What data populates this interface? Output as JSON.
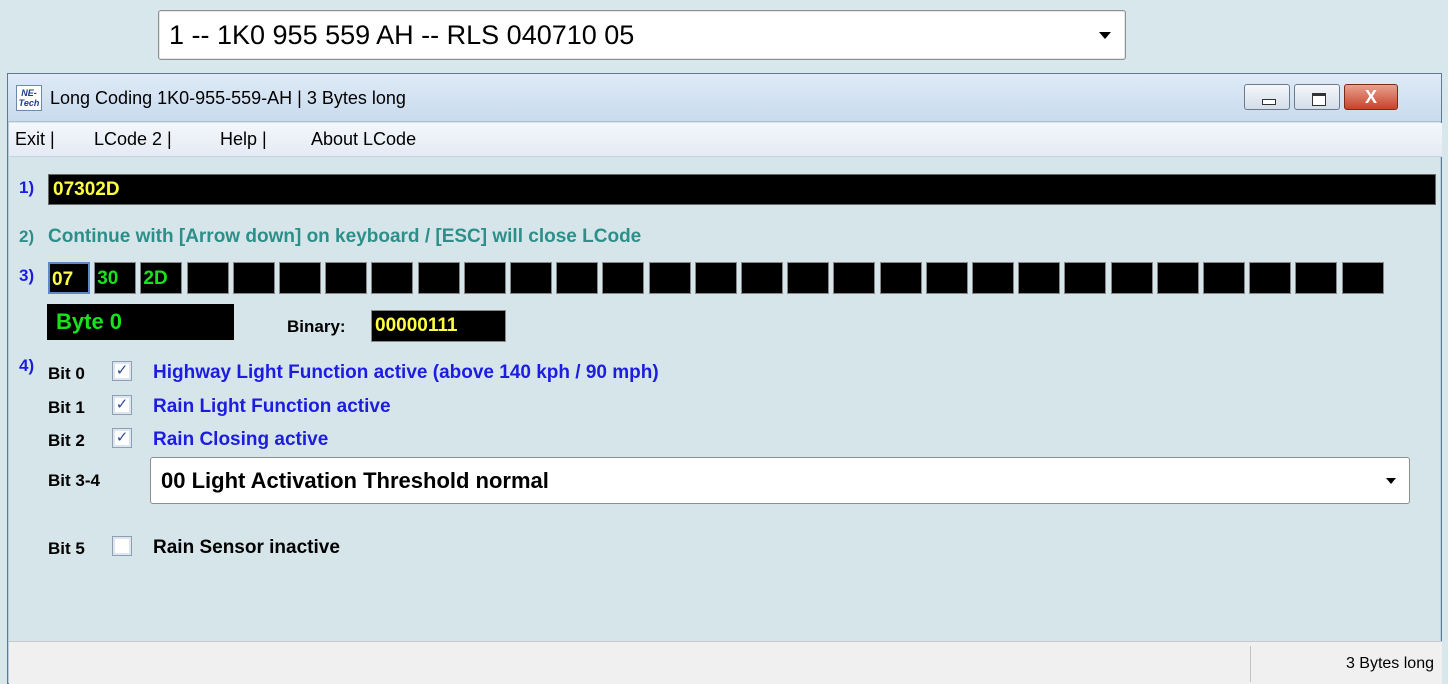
{
  "module_selector": {
    "value": "1 -- 1K0 955 559 AH -- RLS 040710 05"
  },
  "window": {
    "title": "Long Coding  1K0-955-559-AH | 3 Bytes long",
    "icon_text": "NE-Tech",
    "buttons": {
      "close_glyph": "X"
    }
  },
  "menu": [
    "Exit |",
    "LCode 2 |",
    "Help |",
    "About LCode"
  ],
  "rows": {
    "r1": "1)",
    "r2": "2)",
    "r3": "3)",
    "r4": "4)"
  },
  "coding_value": "07302D",
  "hint": "Continue with [Arrow down] on keyboard / [ESC] will close LCode",
  "bytes": [
    "07",
    "30",
    "2D",
    "",
    "",
    "",
    "",
    "",
    "",
    "",
    "",
    "",
    "",
    "",
    "",
    "",
    "",
    "",
    "",
    "",
    "",
    "",
    "",
    "",
    "",
    "",
    "",
    "",
    ""
  ],
  "byte_label": "Byte 0",
  "binary": {
    "label": "Binary:",
    "value": "00000111"
  },
  "bits": [
    {
      "label": "Bit 0",
      "checked": true,
      "description": "Highway Light Function active (above 140 kph / 90 mph)"
    },
    {
      "label": "Bit 1",
      "checked": true,
      "description": "Rain Light Function active"
    },
    {
      "label": "Bit 2",
      "checked": true,
      "description": "Rain Closing active"
    },
    {
      "label": "Bit 3-4",
      "select": "00 Light Activation Threshold normal"
    },
    {
      "label": "Bit 5",
      "checked": false,
      "description": "Rain Sensor inactive"
    }
  ],
  "status": {
    "text": "3 Bytes long"
  },
  "colors": {
    "accent_green": "#16e41a",
    "accent_yellow": "#ffff40",
    "link_blue": "#1d1de0",
    "hint_teal": "#2d8f8a"
  }
}
